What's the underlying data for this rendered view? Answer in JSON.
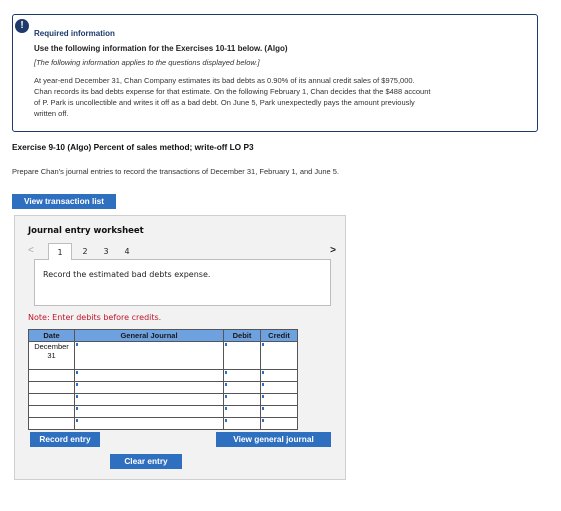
{
  "required_info": {
    "icon": "alert-icon",
    "icon_glyph": "!",
    "title": "Required information",
    "subtitle": "Use the following information for the Exercises 10-11 below. (Algo)",
    "italic_note": "[The following information applies to the questions displayed below.]",
    "body": "At year-end December 31, Chan Company estimates its bad debts as 0.90% of its annual credit sales of $975,000. Chan records its bad debts expense for that estimate. On the following February 1, Chan decides that the $488 account of P. Park is uncollectible and writes it off as a bad debt. On June 5, Park unexpectedly pays the amount previously written off."
  },
  "exercise": {
    "title": "Exercise 9-10 (Algo) Percent of sales method; write-off LO P3",
    "instruction": "Prepare Chan's journal entries to record the transactions of December 31, February 1, and June 5.",
    "view_transaction_list_label": "View transaction list"
  },
  "worksheet": {
    "title": "Journal entry worksheet",
    "prev_arrow": "<",
    "next_arrow": ">",
    "tabs": [
      {
        "label": "1",
        "active": true
      },
      {
        "label": "2",
        "active": false
      },
      {
        "label": "3",
        "active": false
      },
      {
        "label": "4",
        "active": false
      }
    ],
    "record_instruction": "Record the estimated bad debts expense.",
    "note": "Note: Enter debits before credits.",
    "table": {
      "headers": [
        "Date",
        "General Journal",
        "Debit",
        "Credit"
      ],
      "rows": [
        {
          "date_line1": "December",
          "date_line2": "31",
          "general_journal": "",
          "debit": "",
          "credit": ""
        },
        {
          "date_line1": "",
          "date_line2": "",
          "general_journal": "",
          "debit": "",
          "credit": ""
        },
        {
          "date_line1": "",
          "date_line2": "",
          "general_journal": "",
          "debit": "",
          "credit": ""
        },
        {
          "date_line1": "",
          "date_line2": "",
          "general_journal": "",
          "debit": "",
          "credit": ""
        },
        {
          "date_line1": "",
          "date_line2": "",
          "general_journal": "",
          "debit": "",
          "credit": ""
        },
        {
          "date_line1": "",
          "date_line2": "",
          "general_journal": "",
          "debit": "",
          "credit": ""
        }
      ]
    },
    "buttons": {
      "record_entry": "Record entry",
      "clear_entry": "Clear entry",
      "view_general_journal": "View general journal"
    }
  },
  "colors": {
    "primary_button": "#2f6fc0",
    "header_blue": "#6ea1df",
    "note_red": "#c0142b",
    "info_border": "#1d3a6b"
  }
}
